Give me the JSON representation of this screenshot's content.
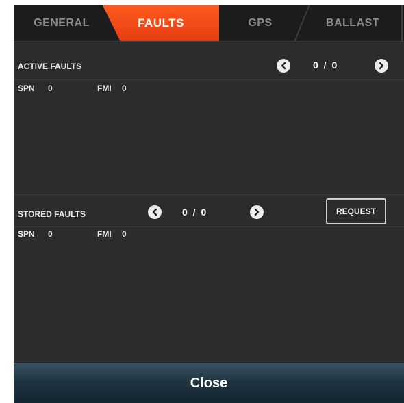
{
  "tabs": [
    {
      "label": "GENERAL"
    },
    {
      "label": "FAULTS"
    },
    {
      "label": "GPS"
    },
    {
      "label": "BALLAST"
    }
  ],
  "active_tab": "FAULTS",
  "active_faults": {
    "title": "ACTIVE FAULTS",
    "counter": "0 / 0",
    "spn_label": "SPN",
    "spn_value": "0",
    "fmi_label": "FMI",
    "fmi_value": "0"
  },
  "stored_faults": {
    "title": "STORED FAULTS",
    "counter": "0 / 0",
    "spn_label": "SPN",
    "spn_value": "0",
    "fmi_label": "FMI",
    "fmi_value": "0",
    "request_label": "REQUEST"
  },
  "close_label": "Close",
  "colors": {
    "accent": "#f04a18",
    "panel": "#2c2c2c",
    "tabbar": "#1c1c1c",
    "close_bar": "#1f3442"
  },
  "icons": [
    "chevron-left-icon",
    "chevron-right-icon"
  ]
}
